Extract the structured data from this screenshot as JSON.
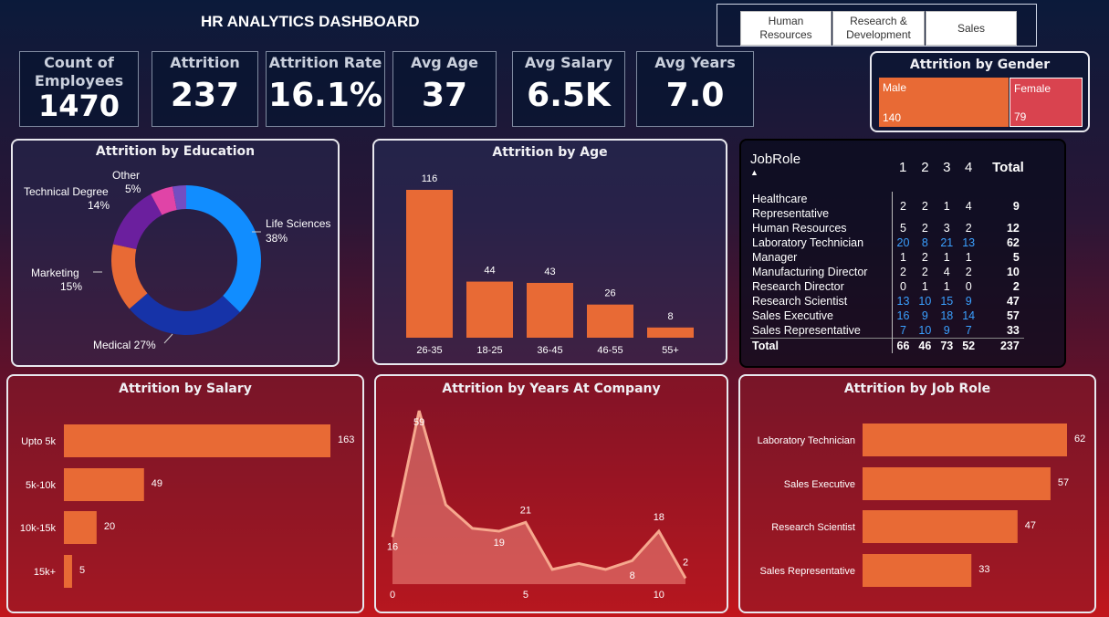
{
  "title": "HR ANALYTICS DASHBOARD",
  "slicer": [
    "Human Resources",
    "Research & Development",
    "Sales"
  ],
  "kpis": [
    {
      "label": "Count of Employees",
      "value": "1470"
    },
    {
      "label": "Attrition",
      "value": "237"
    },
    {
      "label": "Attrition Rate",
      "value": "16.1%"
    },
    {
      "label": "Avg Age",
      "value": "37"
    },
    {
      "label": "Avg Salary",
      "value": "6.5K"
    },
    {
      "label": "Avg Years",
      "value": "7.0"
    }
  ],
  "gender": {
    "title": "Attrition by Gender",
    "male_label": "Male",
    "male_value": "140",
    "female_label": "Female",
    "female_value": "79",
    "colors": {
      "male": "#e86a35",
      "female": "#d9434f"
    }
  },
  "education": {
    "title": "Attrition by Education",
    "slices": [
      {
        "name": "Life Sciences",
        "pct": "38%",
        "value": 38,
        "color": "#118dff"
      },
      {
        "name": "Medical",
        "pct": "27%",
        "value": 27,
        "color": "#1633a8"
      },
      {
        "name": "Marketing",
        "pct": "15%",
        "value": 15,
        "color": "#e86a35"
      },
      {
        "name": "Technical Degree",
        "pct": "14%",
        "value": 14,
        "color": "#6b1f9e"
      },
      {
        "name": "Other",
        "pct": "5%",
        "value": 5,
        "color": "#e044a7"
      },
      {
        "name": "",
        "pct": "",
        "value": 3,
        "color": "#744ec2"
      }
    ]
  },
  "age": {
    "title": "Attrition by Age",
    "categories": [
      "26-35",
      "18-25",
      "36-45",
      "46-55",
      "55+"
    ],
    "values": [
      116,
      44,
      43,
      26,
      8
    ]
  },
  "matrix": {
    "header_role": "JobRole",
    "columns": [
      "1",
      "2",
      "3",
      "4",
      "Total"
    ],
    "rows": [
      {
        "role": "Healthcare Representative",
        "vals": [
          "2",
          "2",
          "1",
          "4"
        ],
        "total": "9"
      },
      {
        "role": "Human Resources",
        "vals": [
          "5",
          "2",
          "3",
          "2"
        ],
        "total": "12"
      },
      {
        "role": "Laboratory Technician",
        "vals": [
          "20",
          "8",
          "21",
          "13"
        ],
        "total": "62"
      },
      {
        "role": "Manager",
        "vals": [
          "1",
          "2",
          "1",
          "1"
        ],
        "total": "5"
      },
      {
        "role": "Manufacturing Director",
        "vals": [
          "2",
          "2",
          "4",
          "2"
        ],
        "total": "10"
      },
      {
        "role": "Research Director",
        "vals": [
          "0",
          "1",
          "1",
          "0"
        ],
        "total": "2"
      },
      {
        "role": "Research Scientist",
        "vals": [
          "13",
          "10",
          "15",
          "9"
        ],
        "total": "47"
      },
      {
        "role": "Sales Executive",
        "vals": [
          "16",
          "9",
          "18",
          "14"
        ],
        "total": "57"
      },
      {
        "role": "Sales Representative",
        "vals": [
          "7",
          "10",
          "9",
          "7"
        ],
        "total": "33"
      }
    ],
    "blue_rows": [
      2,
      6,
      7,
      8
    ],
    "total_row": {
      "role": "Total",
      "vals": [
        "66",
        "46",
        "73",
        "52"
      ],
      "total": "237"
    }
  },
  "salary": {
    "title": "Attrition by Salary",
    "categories": [
      "Upto 5k",
      "5k-10k",
      "10k-15k",
      "15k+"
    ],
    "values": [
      163,
      49,
      20,
      5
    ]
  },
  "years": {
    "title": "Attrition by Years At Company",
    "x": [
      0,
      1,
      2,
      3,
      4,
      5,
      6,
      7,
      8,
      9,
      10,
      11
    ],
    "y": [
      16,
      59,
      27,
      19,
      18,
      21,
      5,
      7,
      5,
      8,
      18,
      2
    ],
    "labeled": {
      "0": "16",
      "1": "59",
      "4": "19",
      "5": "21",
      "9": "8",
      "10": "18",
      "11": "2"
    },
    "x_ticks": [
      "0",
      "5",
      "10"
    ]
  },
  "jobrole": {
    "title": "Attrition by Job Role",
    "categories": [
      "Laboratory Technician",
      "Sales Executive",
      "Research Scientist",
      "Sales Representative"
    ],
    "values": [
      62,
      57,
      47,
      33
    ]
  },
  "chart_data": [
    {
      "type": "bar",
      "title": "Attrition by Age",
      "categories": [
        "26-35",
        "18-25",
        "36-45",
        "46-55",
        "55+"
      ],
      "values": [
        116,
        44,
        43,
        26,
        8
      ]
    },
    {
      "type": "bar",
      "title": "Attrition by Salary",
      "categories": [
        "Upto 5k",
        "5k-10k",
        "10k-15k",
        "15k+"
      ],
      "values": [
        163,
        49,
        20,
        5
      ]
    },
    {
      "type": "area",
      "title": "Attrition by Years At Company",
      "x": [
        0,
        1,
        2,
        3,
        4,
        5,
        6,
        7,
        8,
        9,
        10,
        11
      ],
      "y": [
        16,
        59,
        27,
        19,
        18,
        21,
        5,
        7,
        5,
        8,
        18,
        2
      ]
    },
    {
      "type": "bar",
      "title": "Attrition by Job Role",
      "categories": [
        "Laboratory Technician",
        "Sales Executive",
        "Research Scientist",
        "Sales Representative"
      ],
      "values": [
        62,
        57,
        47,
        33
      ]
    },
    {
      "type": "pie",
      "title": "Attrition by Education",
      "categories": [
        "Life Sciences",
        "Medical",
        "Marketing",
        "Technical Degree",
        "Other"
      ],
      "values": [
        38,
        27,
        15,
        14,
        5
      ]
    }
  ]
}
